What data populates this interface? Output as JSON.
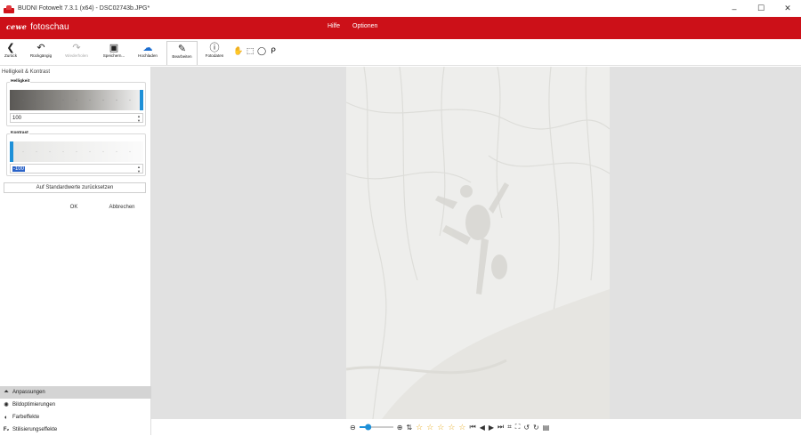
{
  "window": {
    "title": "BUDNI Fotowelt 7.3.1 (x64) - DSC02743b.JPG*",
    "controls": [
      "–",
      "☐",
      "✕"
    ]
  },
  "brand": {
    "logo_mark": "cewe",
    "logo_text": "fotoschau"
  },
  "menu": [
    {
      "label": "Hilfe"
    },
    {
      "label": "Optionen"
    }
  ],
  "toolbar": [
    {
      "label": "Zurück",
      "icon": "back-icon",
      "glyph": "❮"
    },
    {
      "label": "Rückgängig",
      "icon": "undo-icon",
      "glyph": "↶"
    },
    {
      "label": "Wiederholen",
      "icon": "redo-icon",
      "glyph": "↷",
      "disabled": true
    },
    {
      "label": "Speichern...",
      "icon": "save-icon",
      "glyph": "▣"
    },
    {
      "label": "Hochladen",
      "icon": "upload-icon",
      "glyph": "☁"
    },
    {
      "label": "Bearbeiten",
      "icon": "edit-icon",
      "glyph": "✎",
      "active": true
    },
    {
      "label": "Fotodaten",
      "icon": "info-icon",
      "glyph": "ⓘ"
    }
  ],
  "select_tools": [
    {
      "icon": "hand-icon",
      "glyph": "✋"
    },
    {
      "icon": "rect-select-icon",
      "glyph": "⬚"
    },
    {
      "icon": "ellipse-select-icon",
      "glyph": "◯"
    },
    {
      "icon": "lasso-icon",
      "glyph": "ᑭ"
    }
  ],
  "panel": {
    "title": "Helligkeit & Kontrast",
    "brightness": {
      "label": "Helligkeit",
      "value": "100",
      "level": 1.0
    },
    "contrast": {
      "label": "Kontrast",
      "value": "-100",
      "level": 0.0
    },
    "reset_label": "Auf Standardwerte zurücksetzen",
    "ok_label": "OK",
    "cancel_label": "Abbrechen"
  },
  "sections": [
    {
      "label": "Anpassungen",
      "icon": "chevron-up-icon",
      "glyph": "⏶",
      "active": true
    },
    {
      "label": "Bildoptimierungen",
      "icon": "sparkle-icon",
      "glyph": "✺"
    },
    {
      "label": "Farbeffekte",
      "icon": "palette-icon",
      "glyph": "◐"
    },
    {
      "label": "Stilisierungseffekte",
      "icon": "style-fx-icon",
      "glyph": "F₂"
    }
  ],
  "zoom": {
    "level": 0.2
  },
  "rating": {
    "stars": 0,
    "max": 5
  },
  "colors": {
    "brand_red": "#cc1018",
    "accent_blue": "#1e90d8"
  }
}
